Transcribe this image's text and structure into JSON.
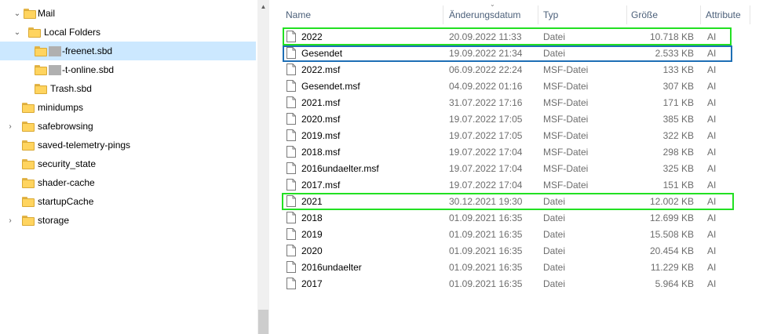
{
  "tree": {
    "items": [
      {
        "label": "Mail",
        "expanded": true,
        "redacted": false
      },
      {
        "label": "Local Folders",
        "expanded": true,
        "redacted": false
      },
      {
        "label": "-freenet.sbd",
        "selected": true,
        "redacted": true
      },
      {
        "label": "-t-online.sbd",
        "redacted": true
      },
      {
        "label": "Trash.sbd",
        "redacted": false
      },
      {
        "label": "minidumps",
        "redacted": false
      },
      {
        "label": "safebrowsing",
        "expandable": true,
        "redacted": false
      },
      {
        "label": "saved-telemetry-pings",
        "redacted": false
      },
      {
        "label": "security_state",
        "redacted": false
      },
      {
        "label": "shader-cache",
        "redacted": false
      },
      {
        "label": "startupCache",
        "redacted": false
      },
      {
        "label": "storage",
        "expandable": true,
        "redacted": false
      }
    ]
  },
  "columns": {
    "name": "Name",
    "date": "Änderungsdatum",
    "type": "Typ",
    "size": "Größe",
    "attr": "Attribute"
  },
  "files": [
    {
      "name": "2022",
      "date": "20.09.2022 11:33",
      "type": "Datei",
      "size": "10.718 KB",
      "attr": "AI",
      "highlight": "green"
    },
    {
      "name": "Gesendet",
      "date": "19.09.2022 21:34",
      "type": "Datei",
      "size": "2.533 KB",
      "attr": "AI",
      "highlight": "blue"
    },
    {
      "name": "2022.msf",
      "date": "06.09.2022 22:24",
      "type": "MSF-Datei",
      "size": "133 KB",
      "attr": "AI"
    },
    {
      "name": "Gesendet.msf",
      "date": "04.09.2022 01:16",
      "type": "MSF-Datei",
      "size": "307 KB",
      "attr": "AI"
    },
    {
      "name": "2021.msf",
      "date": "31.07.2022 17:16",
      "type": "MSF-Datei",
      "size": "171 KB",
      "attr": "AI"
    },
    {
      "name": "2020.msf",
      "date": "19.07.2022 17:05",
      "type": "MSF-Datei",
      "size": "385 KB",
      "attr": "AI"
    },
    {
      "name": "2019.msf",
      "date": "19.07.2022 17:05",
      "type": "MSF-Datei",
      "size": "322 KB",
      "attr": "AI"
    },
    {
      "name": "2018.msf",
      "date": "19.07.2022 17:04",
      "type": "MSF-Datei",
      "size": "298 KB",
      "attr": "AI"
    },
    {
      "name": "2016undaelter.msf",
      "date": "19.07.2022 17:04",
      "type": "MSF-Datei",
      "size": "325 KB",
      "attr": "AI"
    },
    {
      "name": "2017.msf",
      "date": "19.07.2022 17:04",
      "type": "MSF-Datei",
      "size": "151 KB",
      "attr": "AI"
    },
    {
      "name": "2021",
      "date": "30.12.2021 19:30",
      "type": "Datei",
      "size": "12.002 KB",
      "attr": "AI",
      "highlight": "green"
    },
    {
      "name": "2018",
      "date": "01.09.2021 16:35",
      "type": "Datei",
      "size": "12.699 KB",
      "attr": "AI"
    },
    {
      "name": "2019",
      "date": "01.09.2021 16:35",
      "type": "Datei",
      "size": "15.508 KB",
      "attr": "AI"
    },
    {
      "name": "2020",
      "date": "01.09.2021 16:35",
      "type": "Datei",
      "size": "20.454 KB",
      "attr": "AI"
    },
    {
      "name": "2016undaelter",
      "date": "01.09.2021 16:35",
      "type": "Datei",
      "size": "11.229 KB",
      "attr": "AI"
    },
    {
      "name": "2017",
      "date": "01.09.2021 16:35",
      "type": "Datei",
      "size": "5.964 KB",
      "attr": "AI"
    }
  ],
  "colors": {
    "selection": "#cce8ff",
    "highlight_green": "#22e022",
    "highlight_blue": "#1e6fb5"
  }
}
